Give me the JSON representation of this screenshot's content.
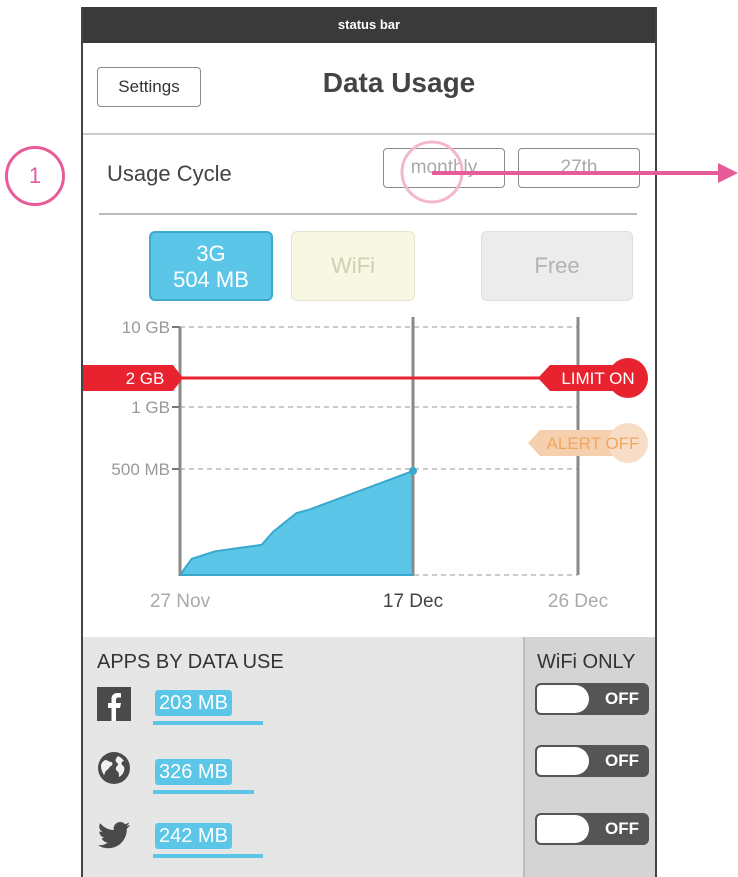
{
  "status_bar": {
    "label": "status bar"
  },
  "header": {
    "settings_label": "Settings",
    "title": "Data Usage"
  },
  "usage_cycle": {
    "label": "Usage Cycle",
    "period": "monthly",
    "reset_day": "27th"
  },
  "network_tabs": {
    "g3": {
      "name": "3G",
      "usage": "504 MB"
    },
    "wifi": {
      "name": "WiFi"
    },
    "free": {
      "name": "Free"
    }
  },
  "chart_data": {
    "type": "area",
    "y_tick_labels": [
      "10 GB",
      "1 GB",
      "500 MB"
    ],
    "x_tick_labels": [
      "27 Nov",
      "17 Dec",
      "26 Dec"
    ],
    "x": [
      0,
      1,
      3,
      7,
      8,
      10,
      11,
      20
    ],
    "y_mb": [
      0,
      78,
      115,
      146,
      210,
      300,
      315,
      504
    ],
    "limit": {
      "value": "2 GB",
      "label": "LIMIT ON"
    },
    "alert": {
      "label": "ALERT OFF"
    },
    "colors": {
      "fill": "#5bc6e8",
      "stroke": "#3aa8cc",
      "limit": "#e8232f",
      "alert": "#f5cfae"
    }
  },
  "apps_panel": {
    "header": "APPS BY DATA USE",
    "wifi_only_header": "WiFi ONLY",
    "apps": [
      {
        "icon": "facebook-icon",
        "usage": "203 MB",
        "usage_fraction": 0.25,
        "wifi_only": "OFF"
      },
      {
        "icon": "globe-icon",
        "usage": "326 MB",
        "usage_fraction": 0.23,
        "wifi_only": "OFF"
      },
      {
        "icon": "twitter-icon",
        "usage": "242 MB",
        "usage_fraction": 0.25,
        "wifi_only": "OFF"
      }
    ]
  },
  "annotation": {
    "number": "1"
  }
}
